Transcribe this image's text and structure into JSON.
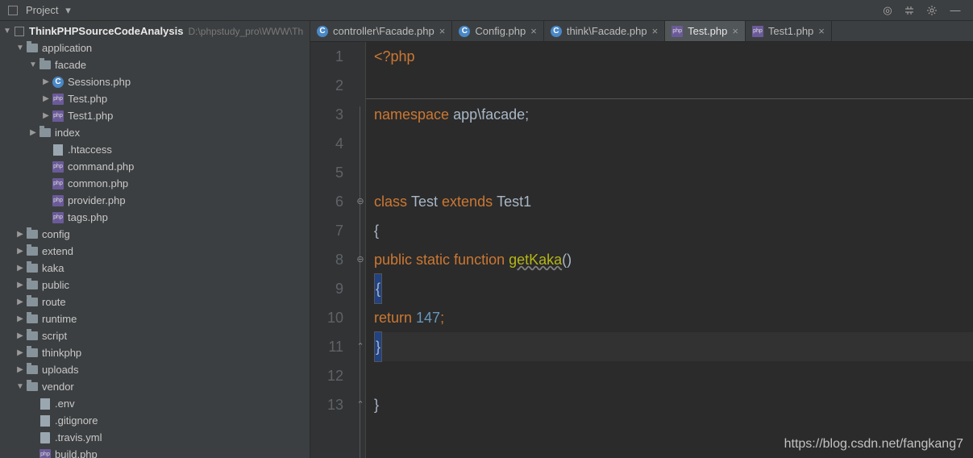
{
  "toolbar": {
    "label": "Project"
  },
  "project_root": {
    "name": "ThinkPHPSourceCodeAnalysis",
    "path": "D:\\phpstudy_pro\\WWW\\Th"
  },
  "tree": [
    {
      "ind": 1,
      "arrow": "down",
      "icon": "dir",
      "name": "application"
    },
    {
      "ind": 2,
      "arrow": "down",
      "icon": "dir",
      "name": "facade"
    },
    {
      "ind": 3,
      "arrow": "right",
      "icon": "c",
      "name": "Sessions.php"
    },
    {
      "ind": 3,
      "arrow": "right",
      "icon": "php",
      "name": "Test.php"
    },
    {
      "ind": 3,
      "arrow": "right",
      "icon": "php",
      "name": "Test1.php"
    },
    {
      "ind": 2,
      "arrow": "right",
      "icon": "dir",
      "name": "index"
    },
    {
      "ind": 3,
      "arrow": "none",
      "icon": "txt",
      "name": ".htaccess"
    },
    {
      "ind": 3,
      "arrow": "none",
      "icon": "php",
      "name": "command.php"
    },
    {
      "ind": 3,
      "arrow": "none",
      "icon": "php",
      "name": "common.php"
    },
    {
      "ind": 3,
      "arrow": "none",
      "icon": "php",
      "name": "provider.php"
    },
    {
      "ind": 3,
      "arrow": "none",
      "icon": "php",
      "name": "tags.php"
    },
    {
      "ind": 1,
      "arrow": "right",
      "icon": "dir",
      "name": "config"
    },
    {
      "ind": 1,
      "arrow": "right",
      "icon": "dir",
      "name": "extend"
    },
    {
      "ind": 1,
      "arrow": "right",
      "icon": "dir",
      "name": "kaka"
    },
    {
      "ind": 1,
      "arrow": "right",
      "icon": "dir",
      "name": "public"
    },
    {
      "ind": 1,
      "arrow": "right",
      "icon": "dir",
      "name": "route"
    },
    {
      "ind": 1,
      "arrow": "right",
      "icon": "dir",
      "name": "runtime"
    },
    {
      "ind": 1,
      "arrow": "right",
      "icon": "dir",
      "name": "script"
    },
    {
      "ind": 1,
      "arrow": "right",
      "icon": "dir",
      "name": "thinkphp"
    },
    {
      "ind": 1,
      "arrow": "right",
      "icon": "dir",
      "name": "uploads"
    },
    {
      "ind": 1,
      "arrow": "down",
      "icon": "dir",
      "name": "vendor"
    },
    {
      "ind": 2,
      "arrow": "none",
      "icon": "txt",
      "name": ".env"
    },
    {
      "ind": 2,
      "arrow": "none",
      "icon": "txt",
      "name": ".gitignore"
    },
    {
      "ind": 2,
      "arrow": "none",
      "icon": "file",
      "name": ".travis.yml"
    },
    {
      "ind": 2,
      "arrow": "none",
      "icon": "php",
      "name": "build.php"
    }
  ],
  "tabs": [
    {
      "icon": "c",
      "label": "controller\\Facade.php",
      "active": false
    },
    {
      "icon": "c",
      "label": "Config.php",
      "active": false
    },
    {
      "icon": "c",
      "label": "think\\Facade.php",
      "active": false
    },
    {
      "icon": "php",
      "label": "Test.php",
      "active": true
    },
    {
      "icon": "php",
      "label": "Test1.php",
      "active": false
    }
  ],
  "code": {
    "lines": [
      "1",
      "2",
      "3",
      "4",
      "5",
      "6",
      "7",
      "8",
      "9",
      "10",
      "11",
      "12",
      "13"
    ],
    "l1_open": "<?php",
    "l3_ns": "namespace ",
    "l3_path": "app\\facade;",
    "l6_class": "class ",
    "l6_name": "Test ",
    "l6_ext": "extends ",
    "l6_parent": "Test1",
    "l7_brace": "{",
    "l8_vis": "public ",
    "l8_static": "static ",
    "l8_func": "function ",
    "l8_name": "getKaka",
    "l8_par": "()",
    "l9_brace": "{",
    "l10_ret": "return ",
    "l10_num": "147",
    "l10_semi": ";",
    "l11_brace": "}",
    "l13_brace": "}"
  },
  "watermark": "https://blog.csdn.net/fangkang7"
}
